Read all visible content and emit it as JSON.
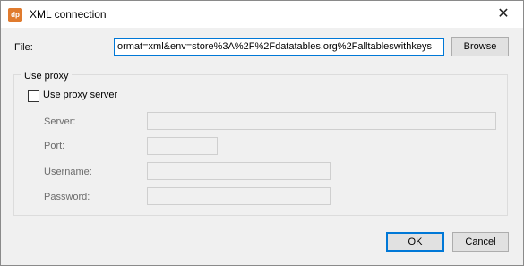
{
  "window": {
    "title": "XML connection",
    "app_icon_text": "dp",
    "close_glyph": "✕"
  },
  "file": {
    "label": "File:",
    "value": "ormat=xml&env=store%3A%2F%2Fdatatables.org%2Falltableswithkeys",
    "browse_label": "Browse"
  },
  "proxy": {
    "group_label": "Use proxy",
    "checkbox_label": "Use proxy server",
    "checked": false,
    "server_label": "Server:",
    "port_label": "Port:",
    "username_label": "Username:",
    "password_label": "Password:",
    "server_value": "",
    "port_value": "",
    "username_value": "",
    "password_value": ""
  },
  "buttons": {
    "ok": "OK",
    "cancel": "Cancel"
  },
  "colors": {
    "accent": "#0078d7",
    "app_icon": "#e07b2e",
    "dialog_bg": "#f0f0f0"
  }
}
